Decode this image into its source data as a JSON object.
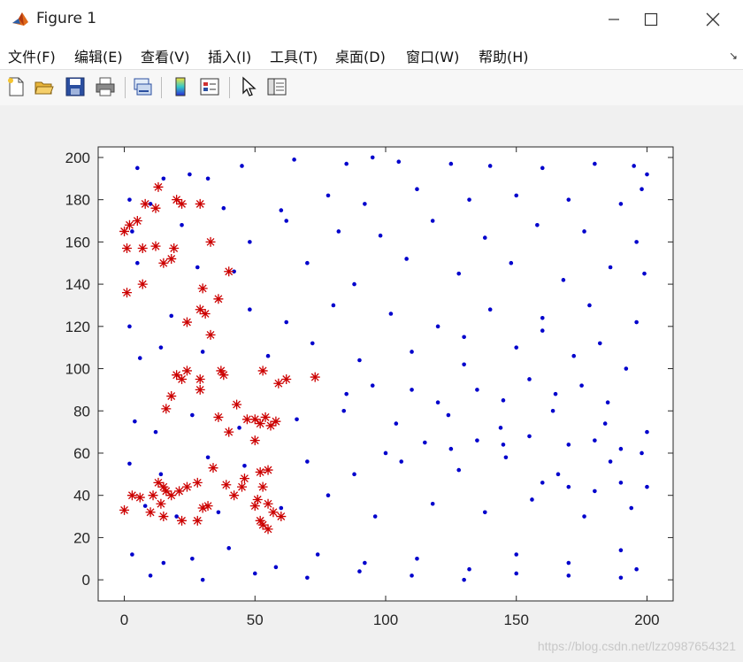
{
  "window": {
    "title": "Figure 1"
  },
  "menu": [
    "文件(F)",
    "编辑(E)",
    "查看(V)",
    "插入(I)",
    "工具(T)",
    "桌面(D)",
    "窗口(W)",
    "帮助(H)"
  ],
  "toolbar": [
    "new-figure",
    "open-file",
    "save",
    "print",
    "link-plot",
    "insert-colorbar",
    "insert-legend",
    "edit-plot",
    "property-inspector"
  ],
  "watermark": "https://blog.csdn.net/lzz0987654321",
  "colors": {
    "inliers": "#0000cc",
    "outliers": "#cc0000",
    "axes_bg": "#ffffff"
  },
  "chart_data": {
    "type": "scatter",
    "xlim": [
      -10,
      210
    ],
    "ylim": [
      -10,
      205
    ],
    "xticks": [
      0,
      50,
      100,
      150,
      200
    ],
    "yticks": [
      0,
      20,
      40,
      60,
      80,
      100,
      120,
      140,
      160,
      180,
      200
    ],
    "grid": false,
    "series": [
      {
        "marker": "dot",
        "color": "#0000cc",
        "points": [
          [
            5,
            195
          ],
          [
            15,
            190
          ],
          [
            25,
            192
          ],
          [
            32,
            190
          ],
          [
            45,
            196
          ],
          [
            65,
            199
          ],
          [
            85,
            197
          ],
          [
            95,
            200
          ],
          [
            105,
            198
          ],
          [
            125,
            197
          ],
          [
            140,
            196
          ],
          [
            160,
            195
          ],
          [
            180,
            197
          ],
          [
            195,
            196
          ],
          [
            200,
            192
          ],
          [
            2,
            180
          ],
          [
            10,
            178
          ],
          [
            38,
            176
          ],
          [
            60,
            175
          ],
          [
            78,
            182
          ],
          [
            92,
            178
          ],
          [
            112,
            185
          ],
          [
            132,
            180
          ],
          [
            150,
            182
          ],
          [
            170,
            180
          ],
          [
            190,
            178
          ],
          [
            198,
            185
          ],
          [
            3,
            165
          ],
          [
            22,
            168
          ],
          [
            48,
            160
          ],
          [
            62,
            170
          ],
          [
            82,
            165
          ],
          [
            98,
            163
          ],
          [
            118,
            170
          ],
          [
            138,
            162
          ],
          [
            158,
            168
          ],
          [
            176,
            165
          ],
          [
            196,
            160
          ],
          [
            5,
            150
          ],
          [
            28,
            148
          ],
          [
            42,
            146
          ],
          [
            70,
            150
          ],
          [
            88,
            140
          ],
          [
            108,
            152
          ],
          [
            128,
            145
          ],
          [
            148,
            150
          ],
          [
            168,
            142
          ],
          [
            186,
            148
          ],
          [
            199,
            145
          ],
          [
            2,
            120
          ],
          [
            18,
            125
          ],
          [
            48,
            128
          ],
          [
            62,
            122
          ],
          [
            80,
            130
          ],
          [
            102,
            126
          ],
          [
            120,
            120
          ],
          [
            140,
            128
          ],
          [
            160,
            124
          ],
          [
            178,
            130
          ],
          [
            196,
            122
          ],
          [
            6,
            105
          ],
          [
            14,
            110
          ],
          [
            30,
            108
          ],
          [
            55,
            106
          ],
          [
            72,
            112
          ],
          [
            90,
            104
          ],
          [
            110,
            108
          ],
          [
            130,
            102
          ],
          [
            150,
            110
          ],
          [
            172,
            106
          ],
          [
            192,
            100
          ],
          [
            4,
            75
          ],
          [
            12,
            70
          ],
          [
            26,
            78
          ],
          [
            44,
            72
          ],
          [
            66,
            76
          ],
          [
            84,
            80
          ],
          [
            104,
            74
          ],
          [
            124,
            78
          ],
          [
            144,
            72
          ],
          [
            164,
            80
          ],
          [
            184,
            74
          ],
          [
            200,
            70
          ],
          [
            2,
            55
          ],
          [
            14,
            50
          ],
          [
            32,
            58
          ],
          [
            46,
            54
          ],
          [
            70,
            56
          ],
          [
            88,
            50
          ],
          [
            106,
            56
          ],
          [
            128,
            52
          ],
          [
            146,
            58
          ],
          [
            166,
            50
          ],
          [
            186,
            56
          ],
          [
            198,
            60
          ],
          [
            8,
            35
          ],
          [
            20,
            30
          ],
          [
            36,
            32
          ],
          [
            60,
            34
          ],
          [
            78,
            40
          ],
          [
            96,
            30
          ],
          [
            118,
            36
          ],
          [
            138,
            32
          ],
          [
            156,
            38
          ],
          [
            176,
            30
          ],
          [
            194,
            34
          ],
          [
            3,
            12
          ],
          [
            15,
            8
          ],
          [
            26,
            10
          ],
          [
            40,
            15
          ],
          [
            58,
            6
          ],
          [
            74,
            12
          ],
          [
            92,
            8
          ],
          [
            112,
            10
          ],
          [
            132,
            5
          ],
          [
            150,
            12
          ],
          [
            170,
            8
          ],
          [
            190,
            14
          ],
          [
            10,
            2
          ],
          [
            30,
            0
          ],
          [
            50,
            3
          ],
          [
            70,
            1
          ],
          [
            90,
            4
          ],
          [
            110,
            2
          ],
          [
            130,
            0
          ],
          [
            150,
            3
          ],
          [
            170,
            2
          ],
          [
            190,
            1
          ],
          [
            196,
            5
          ],
          [
            135,
            90
          ],
          [
            145,
            85
          ],
          [
            155,
            95
          ],
          [
            165,
            88
          ],
          [
            175,
            92
          ],
          [
            185,
            84
          ],
          [
            110,
            90
          ],
          [
            120,
            84
          ],
          [
            95,
            92
          ],
          [
            85,
            88
          ],
          [
            130,
            115
          ],
          [
            160,
            118
          ],
          [
            182,
            112
          ],
          [
            100,
            60
          ],
          [
            115,
            65
          ],
          [
            125,
            62
          ],
          [
            135,
            66
          ],
          [
            145,
            64
          ],
          [
            155,
            68
          ],
          [
            170,
            64
          ],
          [
            180,
            66
          ],
          [
            190,
            62
          ],
          [
            200,
            44
          ],
          [
            190,
            46
          ],
          [
            180,
            42
          ],
          [
            170,
            44
          ],
          [
            160,
            46
          ]
        ]
      },
      {
        "marker": "asterisk",
        "color": "#cc0000",
        "points": [
          [
            0,
            165
          ],
          [
            2,
            168
          ],
          [
            5,
            170
          ],
          [
            8,
            178
          ],
          [
            12,
            176
          ],
          [
            13,
            186
          ],
          [
            20,
            180
          ],
          [
            22,
            178
          ],
          [
            29,
            178
          ],
          [
            1,
            157
          ],
          [
            7,
            157
          ],
          [
            12,
            158
          ],
          [
            18,
            152
          ],
          [
            19,
            157
          ],
          [
            33,
            160
          ],
          [
            15,
            150
          ],
          [
            7,
            140
          ],
          [
            30,
            138
          ],
          [
            36,
            133
          ],
          [
            40,
            146
          ],
          [
            1,
            136
          ],
          [
            29,
            128
          ],
          [
            31,
            126
          ],
          [
            24,
            122
          ],
          [
            33,
            116
          ],
          [
            20,
            97
          ],
          [
            22,
            95
          ],
          [
            24,
            99
          ],
          [
            29,
            95
          ],
          [
            37,
            99
          ],
          [
            38,
            97
          ],
          [
            18,
            87
          ],
          [
            29,
            90
          ],
          [
            16,
            81
          ],
          [
            36,
            77
          ],
          [
            43,
            83
          ],
          [
            53,
            99
          ],
          [
            59,
            93
          ],
          [
            62,
            95
          ],
          [
            73,
            96
          ],
          [
            47,
            76
          ],
          [
            50,
            76
          ],
          [
            52,
            74
          ],
          [
            54,
            77
          ],
          [
            56,
            73
          ],
          [
            58,
            75
          ],
          [
            50,
            66
          ],
          [
            40,
            70
          ],
          [
            0,
            33
          ],
          [
            3,
            40
          ],
          [
            6,
            39
          ],
          [
            11,
            40
          ],
          [
            13,
            46
          ],
          [
            15,
            44
          ],
          [
            16,
            42
          ],
          [
            14,
            36
          ],
          [
            18,
            40
          ],
          [
            21,
            42
          ],
          [
            24,
            44
          ],
          [
            28,
            46
          ],
          [
            30,
            34
          ],
          [
            32,
            35
          ],
          [
            28,
            28
          ],
          [
            22,
            28
          ],
          [
            15,
            30
          ],
          [
            10,
            32
          ],
          [
            34,
            53
          ],
          [
            39,
            45
          ],
          [
            42,
            40
          ],
          [
            45,
            44
          ],
          [
            46,
            48
          ],
          [
            52,
            51
          ],
          [
            55,
            52
          ],
          [
            53,
            44
          ],
          [
            51,
            38
          ],
          [
            55,
            36
          ],
          [
            57,
            32
          ],
          [
            60,
            30
          ],
          [
            52,
            28
          ],
          [
            53,
            26
          ],
          [
            55,
            24
          ],
          [
            50,
            35
          ]
        ]
      }
    ]
  }
}
